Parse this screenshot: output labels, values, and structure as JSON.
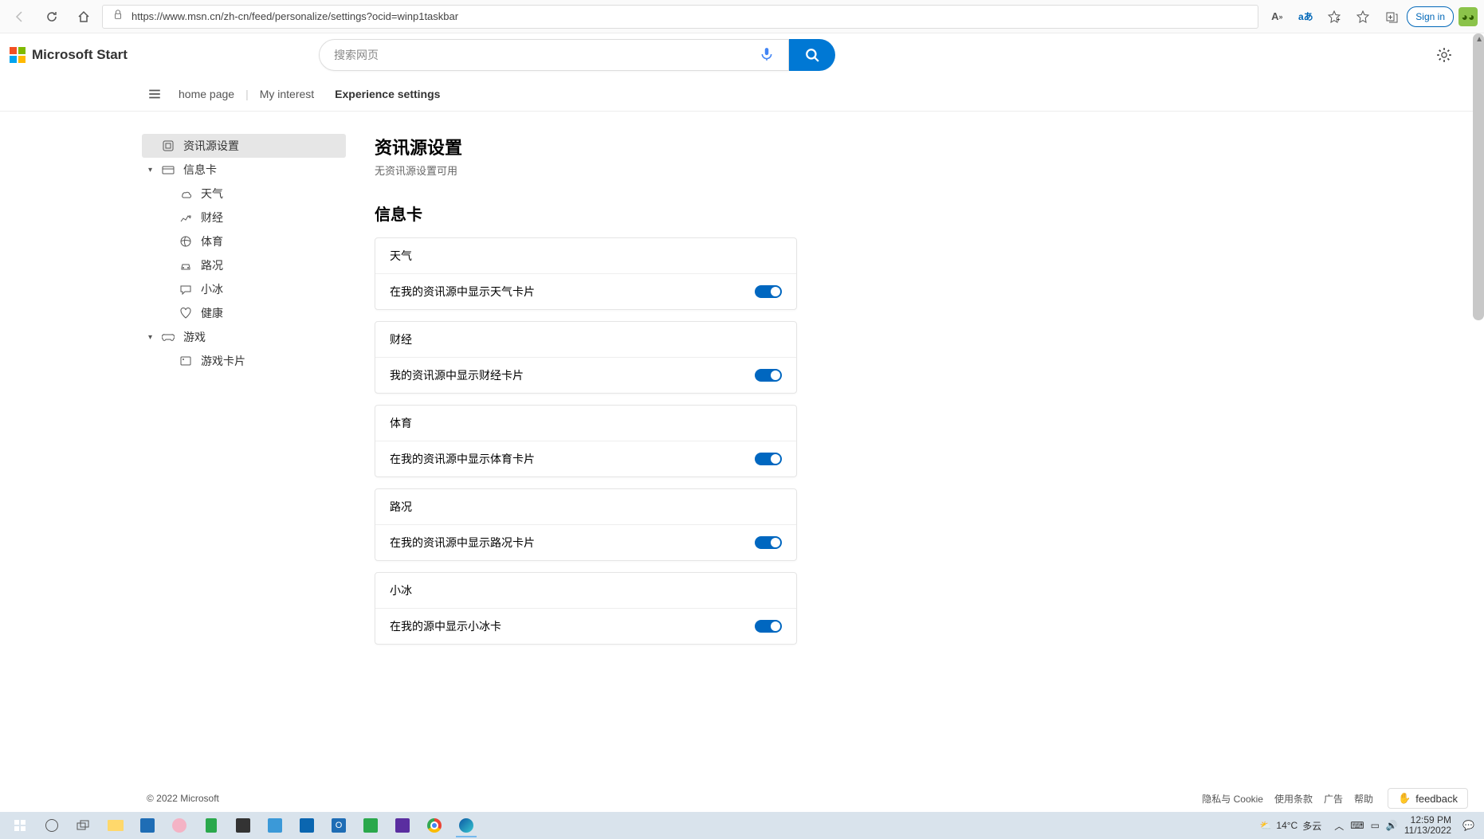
{
  "browser": {
    "url": "https://www.msn.cn/zh-cn/feed/personalize/settings?ocid=winp1taskbar",
    "signin": "Sign in"
  },
  "header": {
    "brand": "Microsoft Start",
    "search_placeholder": "搜索网页"
  },
  "nav": {
    "home": "home page",
    "interest": "My interest",
    "experience": "Experience settings"
  },
  "sidebar": {
    "feed_settings": "资讯源设置",
    "info_card": "信息卡",
    "weather": "天气",
    "finance": "财经",
    "sports": "体育",
    "traffic": "路况",
    "xiaobing": "小冰",
    "health": "健康",
    "games": "游戏",
    "game_cards": "游戏卡片"
  },
  "main": {
    "feed_title": "资讯源设置",
    "feed_sub": "无资讯源设置可用",
    "cards_title": "信息卡",
    "cards": [
      {
        "title": "天气",
        "toggle_label": "在我的资讯源中显示天气卡片"
      },
      {
        "title": "财经",
        "toggle_label": "我的资讯源中显示财经卡片"
      },
      {
        "title": "体育",
        "toggle_label": "在我的资讯源中显示体育卡片"
      },
      {
        "title": "路况",
        "toggle_label": "在我的资讯源中显示路况卡片"
      },
      {
        "title": "小冰",
        "toggle_label": "在我的源中显示小冰卡"
      }
    ]
  },
  "footer": {
    "copyright": "© 2022 Microsoft",
    "privacy": "隐私与 Cookie",
    "terms": "使用条款",
    "ads": "广告",
    "help": "帮助",
    "feedback": "feedback"
  },
  "taskbar": {
    "weather_temp": "14°C",
    "weather_cond": "多云",
    "time": "12:59 PM",
    "date": "11/13/2022"
  }
}
